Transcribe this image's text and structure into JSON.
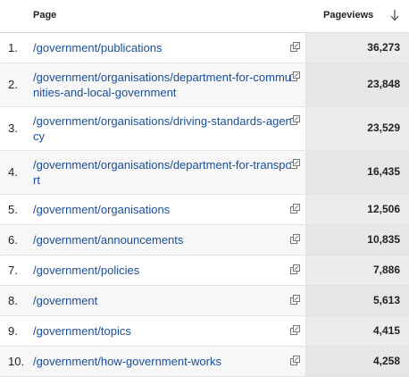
{
  "header": {
    "page_label": "Page",
    "pageviews_label": "Pageviews"
  },
  "rows": [
    {
      "rank": "1.",
      "page": "/government/publications",
      "pageviews": "36,273"
    },
    {
      "rank": "2.",
      "page": "/government/organisations/department-for-communities-and-local-government",
      "pageviews": "23,848"
    },
    {
      "rank": "3.",
      "page": "/government/organisations/driving-standards-agency",
      "pageviews": "23,529"
    },
    {
      "rank": "4.",
      "page": "/government/organisations/department-for-transport",
      "pageviews": "16,435"
    },
    {
      "rank": "5.",
      "page": "/government/organisations",
      "pageviews": "12,506"
    },
    {
      "rank": "6.",
      "page": "/government/announcements",
      "pageviews": "10,835"
    },
    {
      "rank": "7.",
      "page": "/government/policies",
      "pageviews": "7,886"
    },
    {
      "rank": "8.",
      "page": "/government",
      "pageviews": "5,613"
    },
    {
      "rank": "9.",
      "page": "/government/topics",
      "pageviews": "4,415"
    },
    {
      "rank": "10.",
      "page": "/government/how-government-works",
      "pageviews": "4,258"
    }
  ]
}
